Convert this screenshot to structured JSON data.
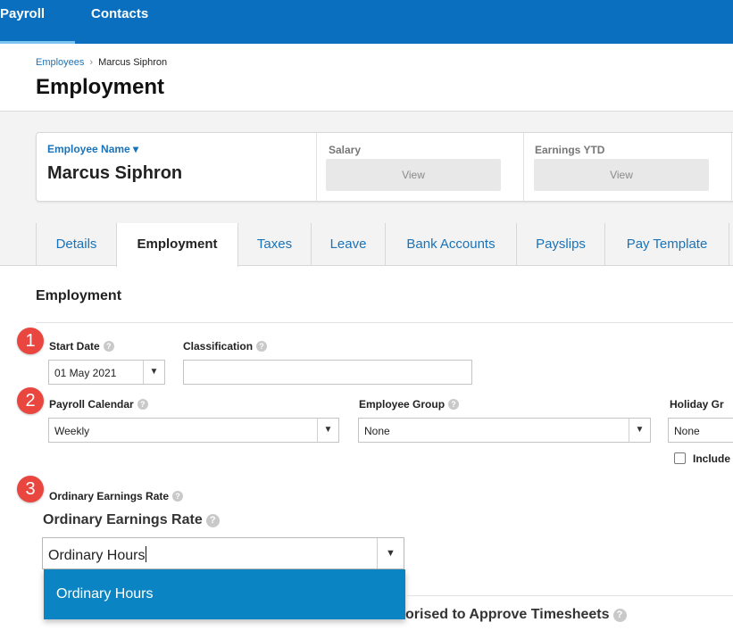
{
  "topnav": {
    "items": [
      "Payroll",
      "Contacts"
    ]
  },
  "breadcrumb": {
    "link": "Employees",
    "separator": "›",
    "current": "Marcus Siphron"
  },
  "page_title": "Employment",
  "summary": {
    "employee_name_label": "Employee Name ▾",
    "employee_name": "Marcus Siphron",
    "salary_label": "Salary",
    "salary_button": "View",
    "earnings_label": "Earnings YTD",
    "earnings_button": "View"
  },
  "tabs": [
    "Details",
    "Employment",
    "Taxes",
    "Leave",
    "Bank Accounts",
    "Payslips",
    "Pay Template"
  ],
  "section_title": "Employment",
  "markers": [
    "1",
    "2",
    "3"
  ],
  "fields": {
    "start_date_label": "Start Date",
    "start_date_value": "01 May 2021",
    "classification_label": "Classification",
    "classification_value": "",
    "payroll_calendar_label": "Payroll Calendar",
    "payroll_calendar_value": "Weekly",
    "employee_group_label": "Employee Group",
    "employee_group_value": "None",
    "holiday_group_label": "Holiday Gr",
    "holiday_group_value": "None",
    "include_label": "Include",
    "ordinary_rate_small_label": "Ordinary Earnings Rate",
    "ordinary_rate_label": "Ordinary Earnings Rate",
    "ordinary_rate_value": "Ordinary Hours",
    "ordinary_rate_option": "Ordinary Hours",
    "approve_partial": "orised to Approve Timesheets"
  },
  "icons": {
    "help": "?",
    "caret": "▼"
  },
  "colors": {
    "brand": "#0b6fc0",
    "link": "#1a73b8",
    "marker": "#e8463f",
    "dropdown_highlight": "#0a84c2"
  }
}
